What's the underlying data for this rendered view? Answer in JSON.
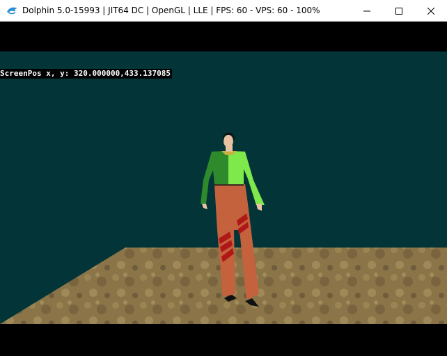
{
  "window": {
    "title": "Dolphin 5.0-15993 | JIT64 DC | OpenGL | LLE | FPS: 60 - VPS: 60 - 100%",
    "app_icon": "dolphin-icon",
    "controls": [
      "minimize-icon",
      "maximize-icon",
      "close-icon"
    ]
  },
  "viewport": {
    "overlay_text": "ScreenPos x, y: 320.000000,433.137085",
    "colors": {
      "wall": "#033538",
      "floor": "#8a7448",
      "shirt_dark": "#2f8a2c",
      "shirt_light": "#7fe84a",
      "pants": "#c4623e",
      "stripes": "#b01818",
      "hair": "#111111",
      "skin": "#e8c3a3",
      "letterbox": "#000000"
    }
  }
}
